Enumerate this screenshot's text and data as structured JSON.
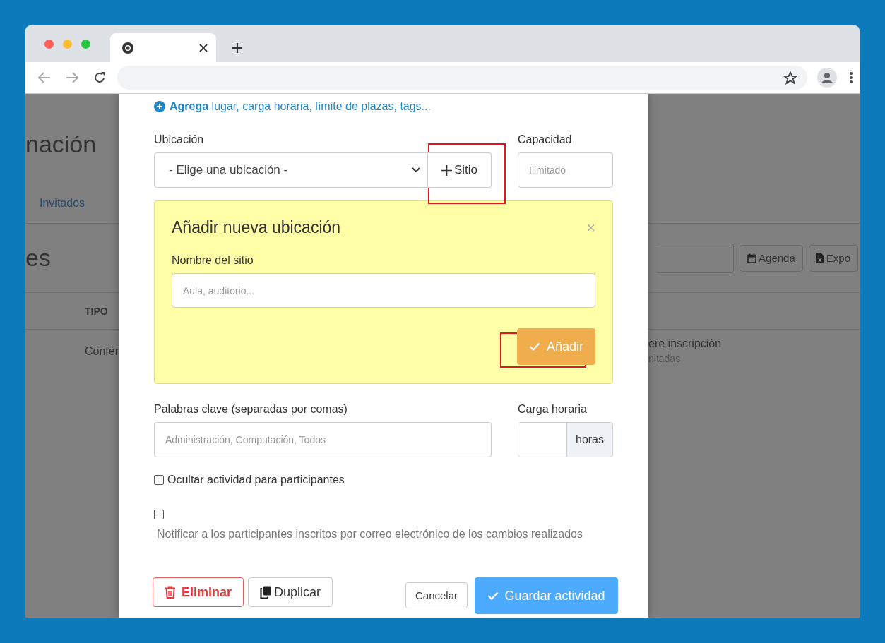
{
  "background": {
    "heading": "nación",
    "nav_link": "Invitados",
    "section_title": "es",
    "buttons": [
      {
        "label": "Agenda",
        "kind": "calendar"
      },
      {
        "label": "Expo",
        "kind": "excel"
      }
    ],
    "table_header": "TIPO",
    "cell": "Confer",
    "right_cell": {
      "title": "ere inscripción",
      "subtitle": "nitadas"
    }
  },
  "modal": {
    "add_more": "**Agrega** lugar, carga horaria, límite de plazas, tags...",
    "location": {
      "label": "Ubicación",
      "value": "- Elige una ubicación -"
    },
    "sitio_button": {
      "label": "Sitio",
      "highlighted": true
    },
    "capacity": {
      "label": "Capacidad",
      "placeholder": "Ilimitado"
    },
    "new_location": {
      "title": "Añadir nueva ubicación",
      "close": "×",
      "field_label": "Nombre del sitio",
      "placeholder": "Aula, auditorio...",
      "add_button": {
        "label": "Añadir",
        "highlighted": true
      }
    },
    "keywords": {
      "label": "Palabras clave (separadas por comas)",
      "placeholder": "Administración, Computación, Todos"
    },
    "hours": {
      "label": "Carga horaria",
      "addon": "horas"
    },
    "checkboxes": [
      {
        "label": "Ocultar actividad para participantes",
        "checked": false,
        "kind": "inline"
      },
      {
        "label": "Notificar a los participantes inscritos por correo electrónico de los cambios realizados",
        "checked": false,
        "kind": "stacked"
      }
    ],
    "actions": [
      {
        "label": "Eliminar",
        "kind": "danger"
      },
      {
        "label": "Duplicar",
        "kind": "copy"
      },
      {
        "label": "Cancelar",
        "kind": "small"
      },
      {
        "label": "Guardar actividad",
        "kind": "primary"
      }
    ]
  }
}
